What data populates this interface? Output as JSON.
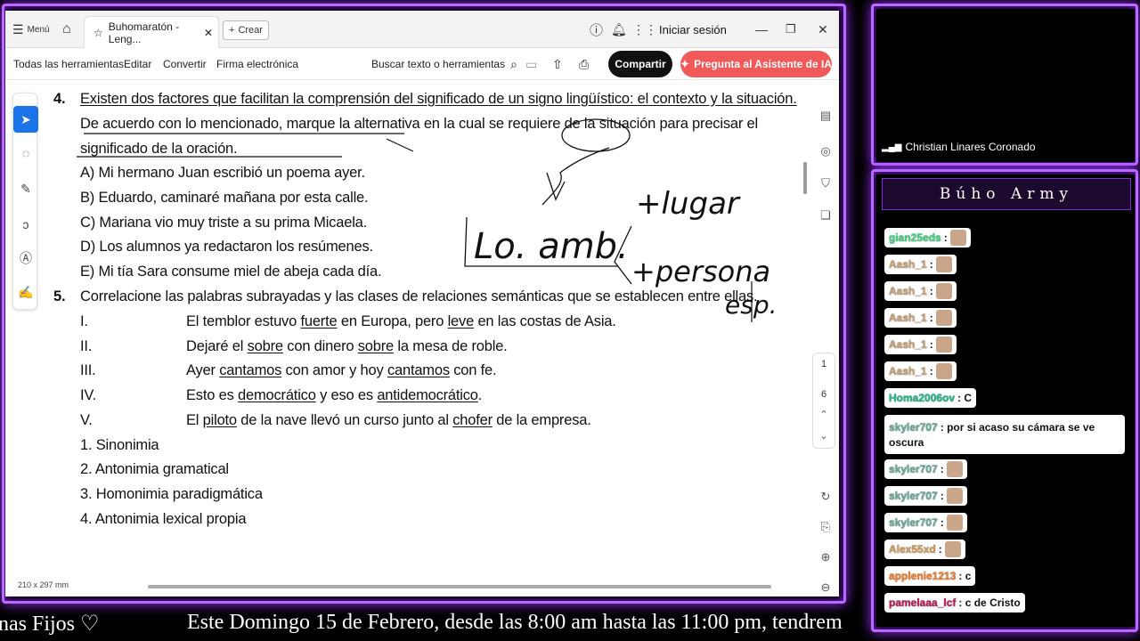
{
  "browser": {
    "menu": "Menú",
    "tab_title": "Buhomaratón - Leng...",
    "new": "Crear",
    "signin": "Iniciar sesión"
  },
  "toolbar": {
    "all_tools": "Todas las herramientas",
    "edit": "Editar",
    "convert": "Convertir",
    "esign": "Firma electrónica",
    "search": "Buscar texto o herramientas",
    "share": "Compartir",
    "ai": "Pregunta al Asistente de IA"
  },
  "doc": {
    "q4_num": "4.",
    "q4_l1": "Existen dos factores que facilitan la comprensión del significado de un signo lingüístico: el contexto y la situación.",
    "q4_l2": "De acuerdo con lo mencionado, marque la alternativa en la cual se requiere de la situación para precisar el",
    "q4_l3": "significado de la oración.",
    "q4_opts": [
      "A) Mi hermano Juan escribió un poema ayer.",
      "B) Eduardo, caminaré mañana por esta calle.",
      "C) Mariana vio muy triste a su prima Micaela.",
      "D) Los alumnos ya redactaron los resúmenes.",
      "E) Mi tía Sara consume miel de abeja cada día."
    ],
    "q5_num": "5.",
    "q5_l1": "Correlacione las palabras subrayadas y las clases de relaciones semánticas que se establecen entre ellas.",
    "q5_items": [
      {
        "roman": "I.",
        "a": "El temblor estuvo ",
        "u1": "fuerte",
        "b": " en Europa, pero ",
        "u2": "leve",
        "c": " en las costas de Asia."
      },
      {
        "roman": "II.",
        "a": "Dejaré el ",
        "u1": "sobre",
        "b": " con dinero ",
        "u2": "sobre",
        "c": " la mesa de roble."
      },
      {
        "roman": "III.",
        "a": "Ayer ",
        "u1": "cantamos",
        "b": " con amor y hoy ",
        "u2": "cantamos",
        "c": " con fe."
      },
      {
        "roman": "IV.",
        "a": "Esto es ",
        "u1": "democrático",
        "b": " y eso es ",
        "u2": "antidemocrático",
        "c": "."
      },
      {
        "roman": "V.",
        "a": "El ",
        "u1": "piloto",
        "b": " de la nave llevó un curso junto al ",
        "u2": "chofer",
        "c": " de la empresa."
      }
    ],
    "q5_opts": [
      "1. Sinonimia",
      "2. Antonimia gramatical",
      "3. Homonimia paradigmática",
      "4. Antonimia lexical propia"
    ],
    "page_size": "210 x 297 mm",
    "page_num": "1",
    "page_total": "6"
  },
  "handwriting": {
    "lugar": "+lugar",
    "lo_amb": "Lo. amb.",
    "persona": "+persona",
    "esp": "esp."
  },
  "camera": {
    "name": "Christian Linares Coronado"
  },
  "chat": {
    "title": "Búho Army",
    "messages": [
      {
        "user": "gian25eds",
        "text": ":",
        "color": "#3ddc84"
      },
      {
        "user": "Aash_1",
        "text": ":",
        "color": "#d2a679"
      },
      {
        "user": "Aash_1",
        "text": ":",
        "color": "#d2a679"
      },
      {
        "user": "Aash_1",
        "text": ":",
        "color": "#d2a679"
      },
      {
        "user": "Aash_1",
        "text": ":",
        "color": "#d2a679"
      },
      {
        "user": "Aash_1",
        "text": ":",
        "color": "#d2a679"
      },
      {
        "user": "Homa2006ov",
        "text": ": C",
        "color": "#1fbf8f"
      },
      {
        "user": "skyler707",
        "text": ": por si acaso su cámara se ve",
        "text2": "oscura",
        "color": "#6ab0a0"
      },
      {
        "user": "skyler707",
        "text": ":",
        "color": "#6ab0a0"
      },
      {
        "user": "skyler707",
        "text": ":",
        "color": "#6ab0a0"
      },
      {
        "user": "skyler707",
        "text": ":",
        "color": "#6ab0a0"
      },
      {
        "user": "Alex55xd",
        "text": ":",
        "color": "#d9a05b"
      },
      {
        "user": "applenie1213",
        "text": ": c",
        "color": "#ff7f27"
      },
      {
        "user": "pamelaaa_lcf",
        "text": ": c de Cristo",
        "color": "#c8195a"
      }
    ]
  },
  "ticker": {
    "left": "nas Fijos ♡",
    "right": "Este Domingo 15 de Febrero, desde las 8:00 am hasta las 11:00 pm, tendrem"
  },
  "colors": {
    "frame": "#b86bff",
    "ai_button": "#f25a5a",
    "share_button": "#111111",
    "active_tool": "#1a73e8"
  }
}
